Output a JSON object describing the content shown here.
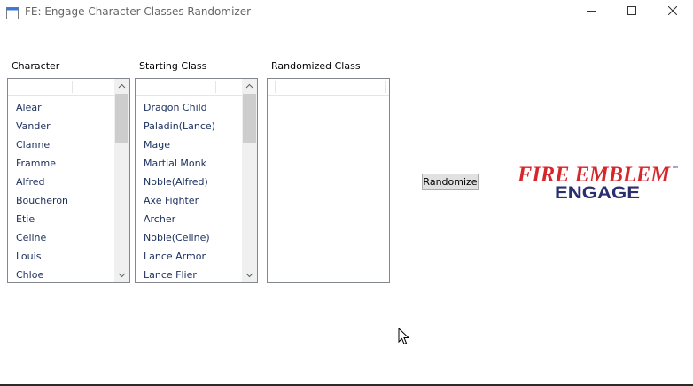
{
  "window": {
    "title": "FE: Engage Character Classes Randomizer",
    "icon": "app-window-icon"
  },
  "window_controls": {
    "minimize_icon": "minimize-icon",
    "maximize_icon": "maximize-icon",
    "close_icon": "close-icon"
  },
  "columns": {
    "character": {
      "label": "Character",
      "items": [
        "Alear",
        "Vander",
        "Clanne",
        "Framme",
        "Alfred",
        "Boucheron",
        "Etie",
        "Celine",
        "Louis",
        "Chloe"
      ]
    },
    "starting_class": {
      "label": "Starting Class",
      "items": [
        "Dragon Child",
        "Paladin(Lance)",
        "Mage",
        "Martial Monk",
        "Noble(Alfred)",
        "Axe Fighter",
        "Archer",
        "Noble(Celine)",
        "Lance Armor",
        "Lance Flier"
      ]
    },
    "randomized_class": {
      "label": "Randomized Class",
      "items": []
    }
  },
  "actions": {
    "randomize_label": "Randomize"
  },
  "logo": {
    "line1": "FIRE EMBLEM",
    "line2": "ENGAGE",
    "tm": "™"
  },
  "colors": {
    "logo_red": "#d6262b",
    "logo_navy": "#2a2f6f",
    "list_text": "#1b2f5e"
  }
}
